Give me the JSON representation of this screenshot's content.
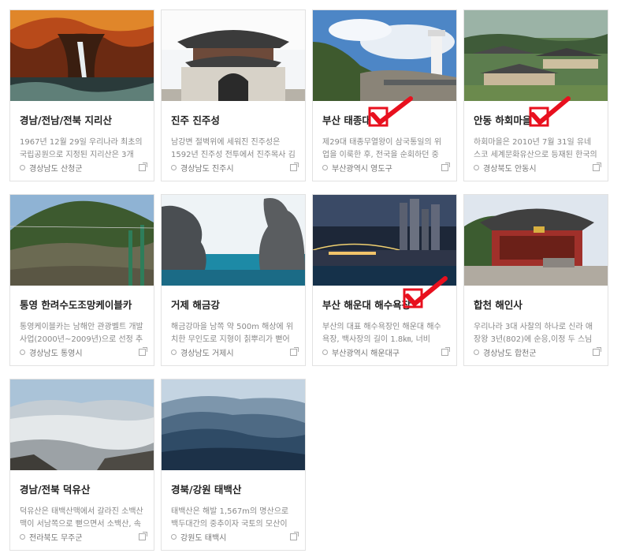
{
  "cards": [
    {
      "title": "경남/전남/전북 지리산",
      "desc": "1967년 12월 29일 우리나라 최초의 국립공원으로 지정된 지리산은 3개도…",
      "location": "경상남도 산청군",
      "icon": "map-pin-icon",
      "checked": false
    },
    {
      "title": "진주 진주성",
      "desc": "남강변 절벽위에 세워진 진주성은 1592년 진주성 전투에서 진주목사 김시민…",
      "location": "경상남도 진주시",
      "icon": "map-pin-icon",
      "checked": false
    },
    {
      "title": "부산 태종대",
      "desc": "제29대 태종무열왕이 삼국통일의 위업을 이룩한 후, 전국을 순회하던 중 이 곳…",
      "location": "부산광역시 영도구",
      "icon": "map-pin-icon",
      "checked": true
    },
    {
      "title": "안동 하회마을",
      "desc": "하회마을은 2010년 7월 31일 유네스코 세계문화유산으로 등재된 한국의 역사…",
      "location": "경상북도 안동시",
      "icon": "map-pin-icon",
      "checked": true
    },
    {
      "title": "통영 한려수도조망케이블카",
      "desc": "통영케이블카는 남해안 관광벨트 개발사업(2000년~2009년)으로 선정 추진되어…",
      "location": "경상남도 통영시",
      "icon": "map-pin-icon",
      "checked": false
    },
    {
      "title": "거제 해금강",
      "desc": "해금강마을 남쪽 약 500m 해상에 위치한 무인도로 지형이 칡뿌리가 뻗어 내린…",
      "location": "경상남도 거제시",
      "icon": "map-pin-icon",
      "checked": false
    },
    {
      "title": "부산 해운대 해수욕장",
      "desc": "부산의 대표 해수욕장인 해운대 해수욕장, 백사장의 길이 1.8㎞, 너비 50m…",
      "location": "부산광역시 해운대구",
      "icon": "map-pin-icon",
      "checked": true
    },
    {
      "title": "합천 해인사",
      "desc": "우리나라 3대 사찰의 하나로 신라 애장왕 3년(802)에 순응,이정 두 스님이 창건…",
      "location": "경상남도 합천군",
      "icon": "map-pin-icon",
      "checked": false
    },
    {
      "title": "경남/전북 덕유산",
      "desc": "덕유산은 태백산맥에서 갈라진 소백산맥이 서남쪽으로 뻗으면서 소백산, 속리산…",
      "location": "전라북도 무주군",
      "icon": "map-pin-icon",
      "checked": false
    },
    {
      "title": "경북/강원 태백산",
      "desc": "태백산은 해발 1,567m의 명산으로 백두대간의 중추이자 국토의 모산이다.",
      "location": "강원도 태백시",
      "icon": "map-pin-icon",
      "checked": false
    }
  ],
  "colors": {
    "check": "#e8101e",
    "title": "#222222",
    "desc": "#888888",
    "border": "#e2e2e2"
  }
}
